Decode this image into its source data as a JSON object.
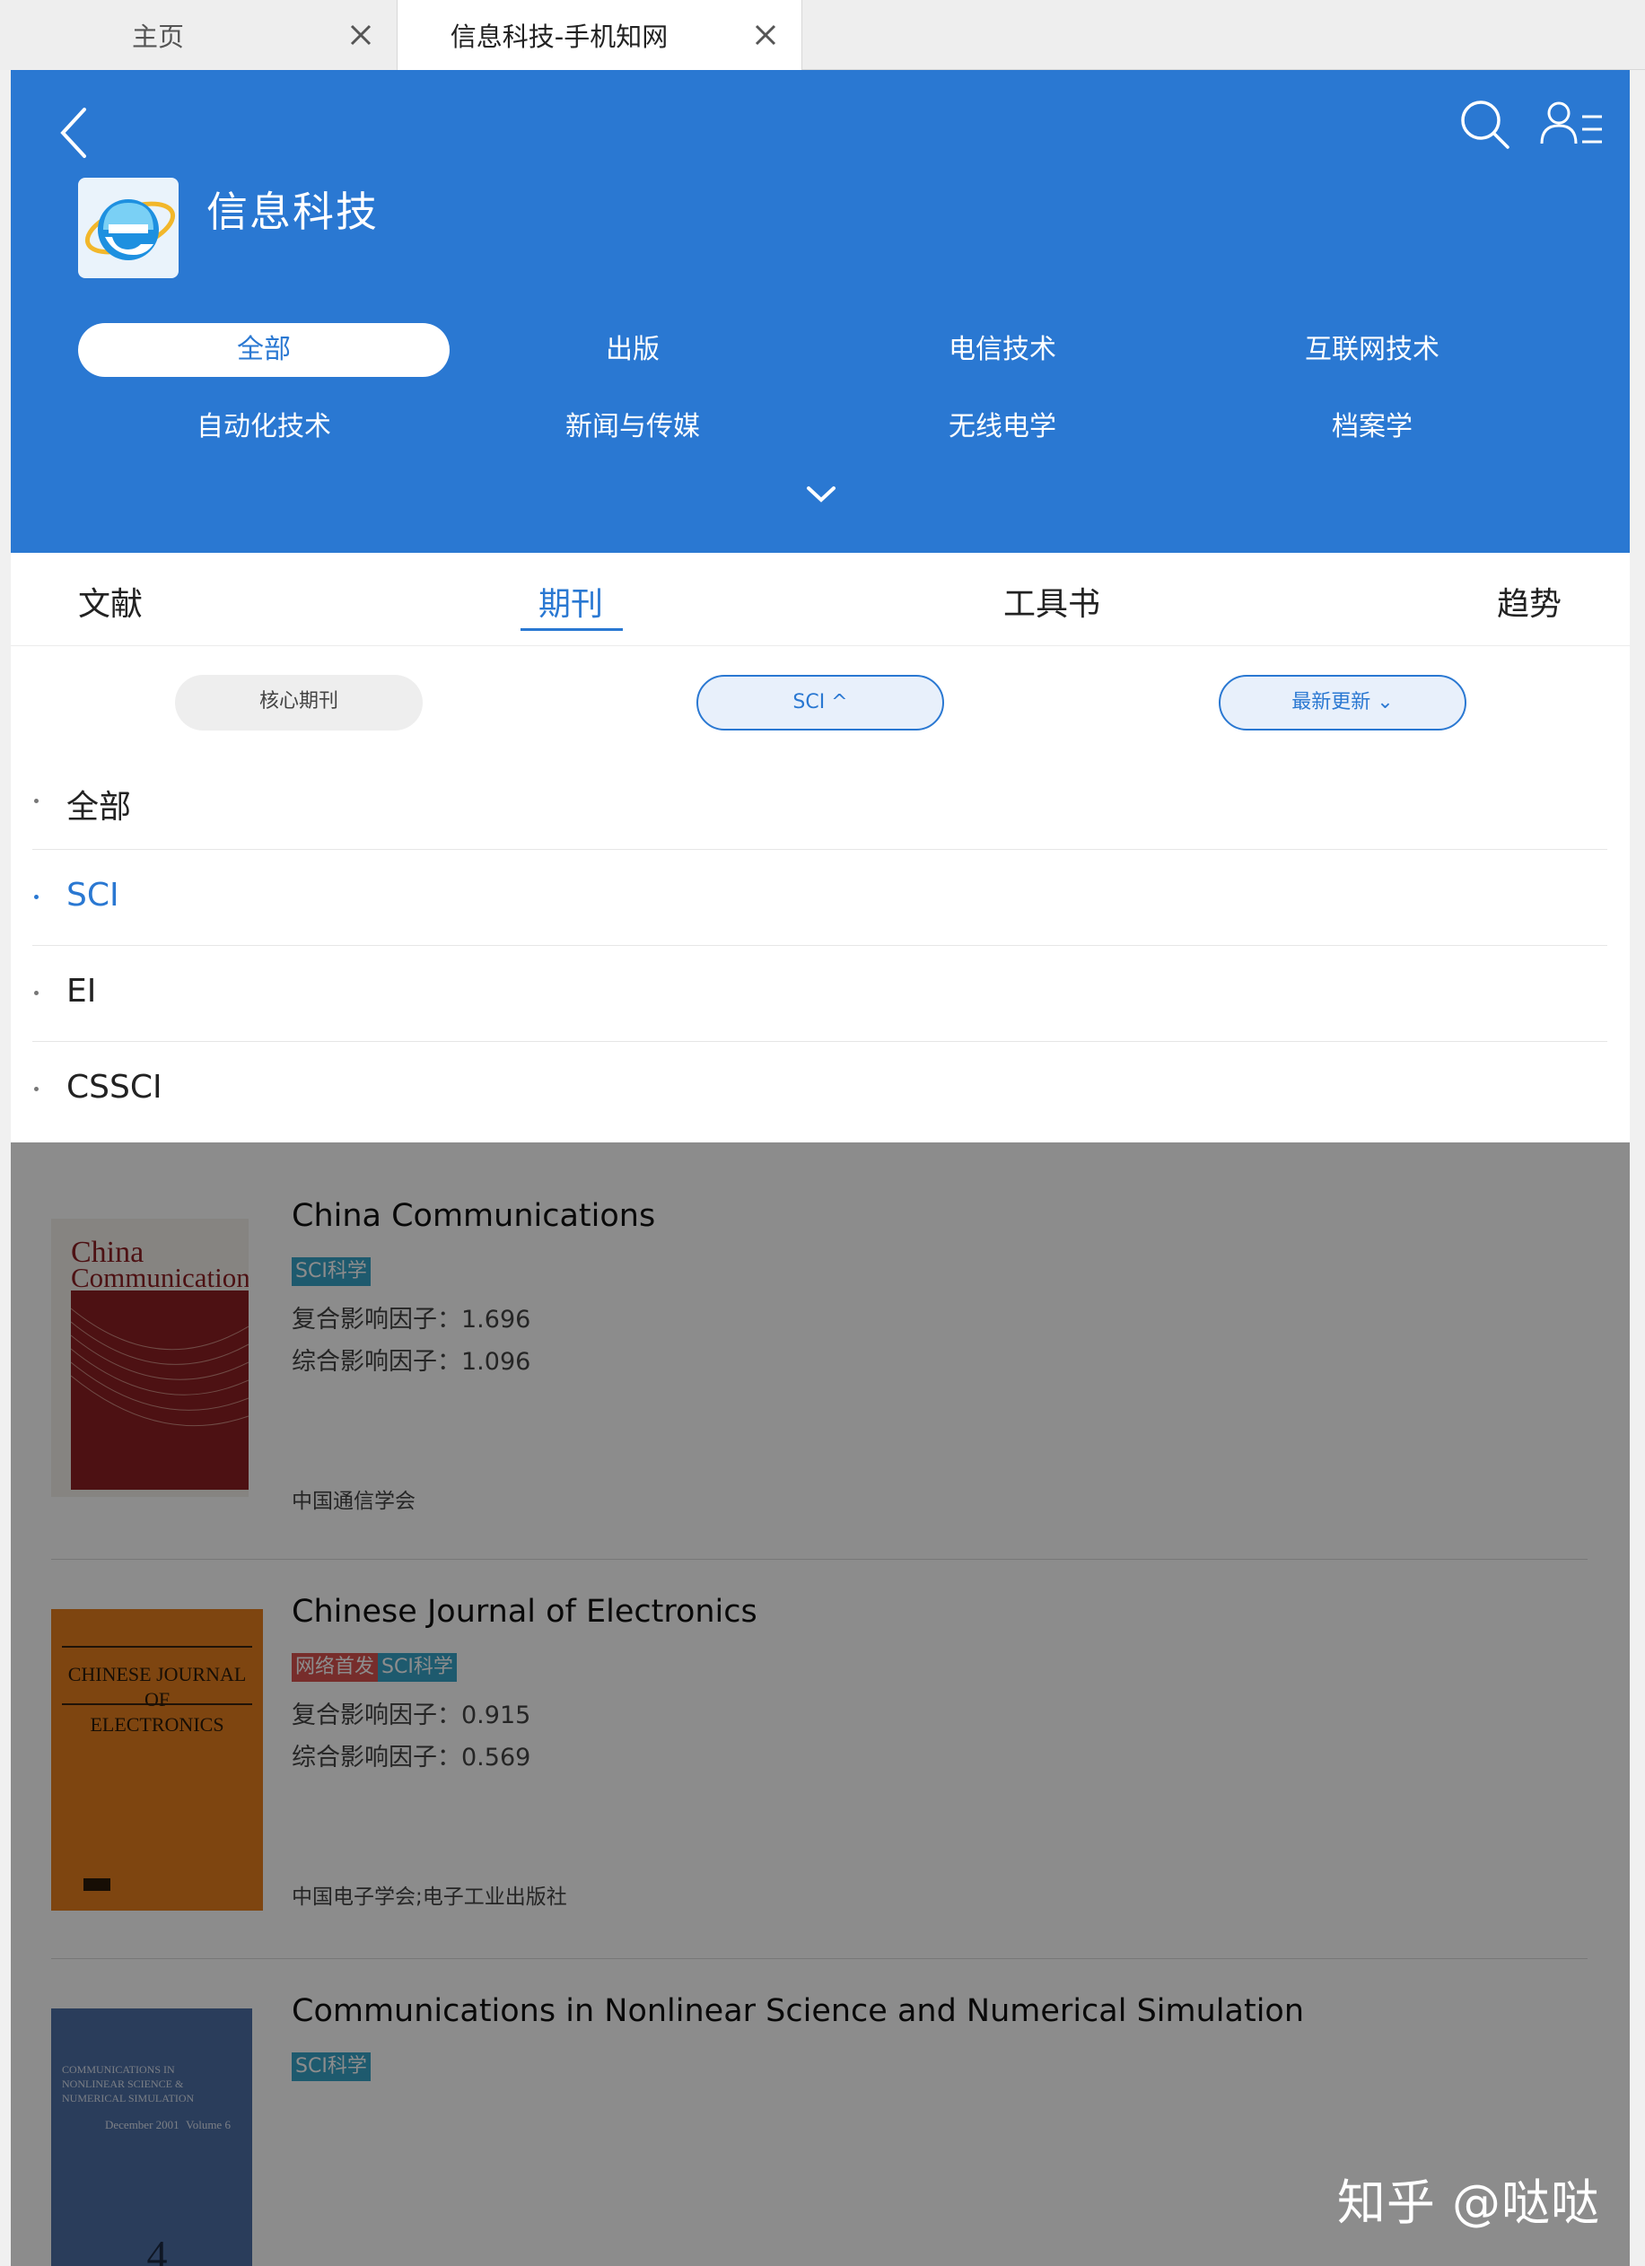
{
  "browser_tabs": [
    {
      "label": "主页"
    },
    {
      "label": "信息科技-手机知网"
    }
  ],
  "header": {
    "title": "信息科技",
    "categories": [
      "全部",
      "出版",
      "电信技术",
      "互联网技术",
      "自动化技术",
      "新闻与传媒",
      "无线电学",
      "档案学"
    ]
  },
  "main_tabs": [
    "文献",
    "期刊",
    "工具书",
    "趋势"
  ],
  "filters": [
    "核心期刊",
    "SCI ^",
    "最新更新 ⌄"
  ],
  "dropdown": [
    "全部",
    "SCI",
    "EI",
    "CSSCI"
  ],
  "journals": [
    {
      "title": "China Communications",
      "tags": [
        "SCI科学"
      ],
      "impact_composite": "复合影响因子：1.696",
      "impact_comprehensive": "综合影响因子：1.096",
      "publisher": "中国通信学会",
      "cover_text": [
        "China",
        "Communications"
      ]
    },
    {
      "title": "Chinese Journal of Electronics",
      "tags": [
        "网络首发",
        "SCI科学"
      ],
      "impact_composite": "复合影响因子：0.915",
      "impact_comprehensive": "综合影响因子：0.569",
      "publisher": "中国电子学会;电子工业出版社",
      "cover_text": [
        "CHINESE JOURNAL",
        "OF",
        "ELECTRONICS"
      ]
    },
    {
      "title": "Communications in Nonlinear Science and Numerical Simulation",
      "tags": [
        "SCI科学"
      ],
      "cover_text": [
        "COMMUNICATIONS IN",
        "NONLINEAR SCIENCE &",
        "NUMERICAL SIMULATION",
        "December 2001",
        "Volume 6",
        "4"
      ]
    }
  ],
  "watermark": "知乎 @哒哒",
  "colors": {
    "brand_blue": "#2a78d2",
    "tag_sci": "#38a4c8",
    "tag_net": "#d9534f"
  }
}
